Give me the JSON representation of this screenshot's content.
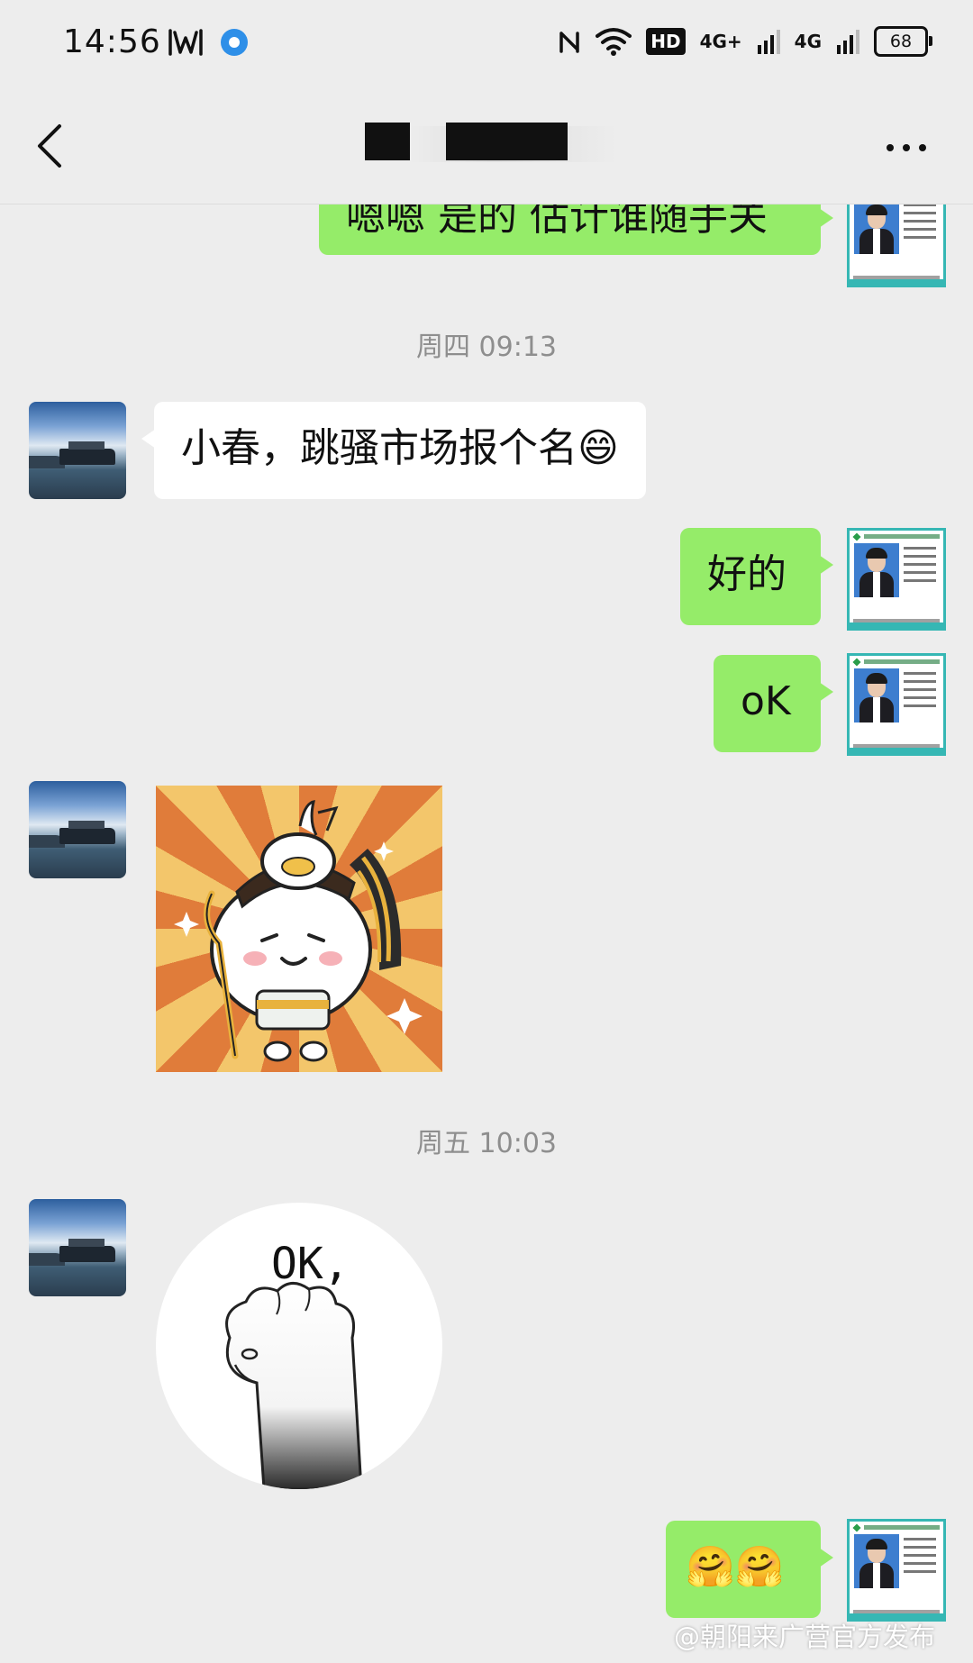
{
  "status_bar": {
    "time": "14:56",
    "hd_label": "HD",
    "network1": "4G+",
    "network2": "4G",
    "battery": "68"
  },
  "header": {
    "icons": [
      "back-icon",
      "more-icon"
    ]
  },
  "messages": [
    {
      "dir": "out",
      "text": "嗯嗯 是的 估计谁随手关"
    },
    {
      "type": "timestamp",
      "text": "周四 09:13"
    },
    {
      "dir": "in",
      "text": "小春，跳骚市场报个名",
      "emoji": "😄"
    },
    {
      "dir": "out",
      "text": "好的"
    },
    {
      "dir": "out",
      "text": "oK"
    },
    {
      "dir": "in",
      "type": "sticker",
      "icon": "cartoon-sticker"
    },
    {
      "type": "timestamp",
      "text": "周五 10:03"
    },
    {
      "dir": "in",
      "type": "sticker",
      "icon": "ok-paw-sticker",
      "text": "OK,"
    },
    {
      "dir": "out",
      "emoji": "🤗🤗"
    }
  ],
  "watermark": "@朝阳来广营官方发布",
  "colors": {
    "background": "#ededed",
    "outgoing_bubble": "#95ec69",
    "incoming_bubble": "#ffffff",
    "timestamp": "#8e8e8e"
  }
}
